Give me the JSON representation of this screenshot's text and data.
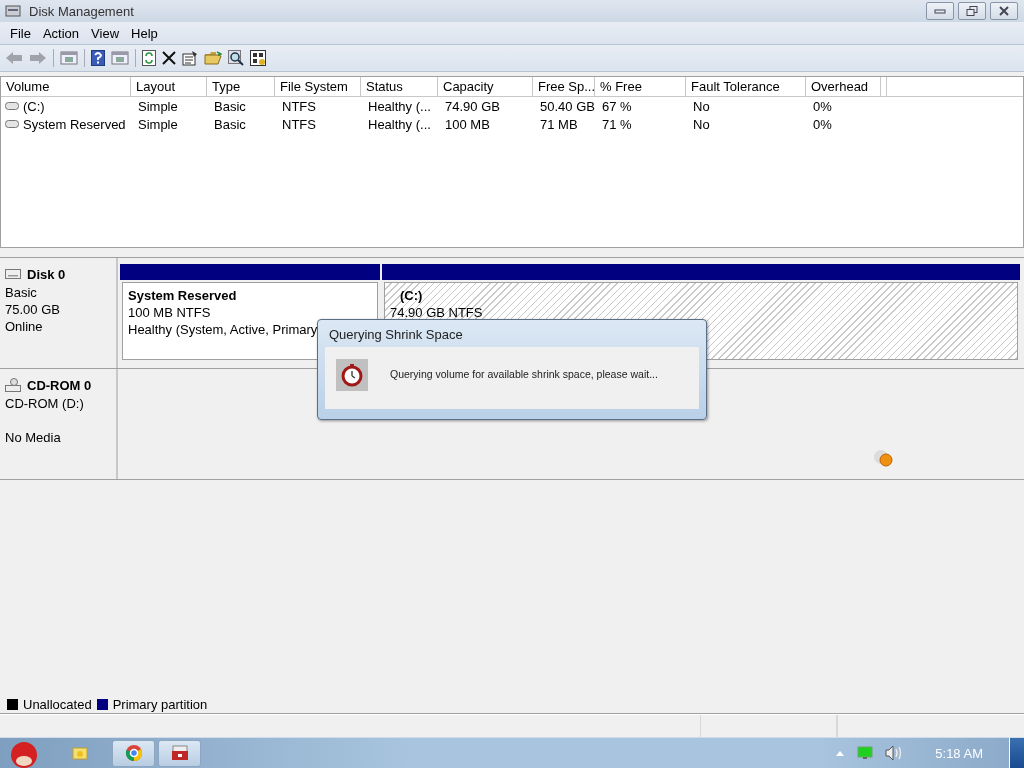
{
  "window": {
    "title": "Disk Management"
  },
  "menu": [
    "File",
    "Action",
    "View",
    "Help"
  ],
  "table": {
    "columns": [
      {
        "label": "Volume"
      },
      {
        "label": "Layout"
      },
      {
        "label": "Type"
      },
      {
        "label": "File System"
      },
      {
        "label": "Status"
      },
      {
        "label": "Capacity"
      },
      {
        "label": "Free Sp..."
      },
      {
        "label": "% Free"
      },
      {
        "label": "Fault Tolerance"
      },
      {
        "label": "Overhead"
      }
    ],
    "rows": [
      {
        "cells": [
          "(C:)",
          "Simple",
          "Basic",
          "NTFS",
          "Healthy (...",
          "74.90 GB",
          "50.40 GB",
          "67 %",
          "No",
          "0%"
        ]
      },
      {
        "cells": [
          "System Reserved",
          "Simple",
          "Basic",
          "NTFS",
          "Healthy (...",
          "100 MB",
          "71 MB",
          "71 %",
          "No",
          "0%"
        ]
      }
    ]
  },
  "disks": [
    {
      "kind": "disk",
      "name": "Disk 0",
      "lines": [
        "Basic",
        "75.00 GB",
        "Online"
      ],
      "partitions": [
        {
          "name": "System Reserved",
          "size": "100 MB NTFS",
          "status": "Healthy (System, Active, Primary",
          "hatched": false
        },
        {
          "name": "(C:)",
          "size": "74.90 GB NTFS",
          "hatched": true
        }
      ]
    },
    {
      "kind": "cdrom",
      "name": "CD-ROM 0",
      "lines": [
        "CD-ROM (D:)",
        "No Media"
      ]
    }
  ],
  "dialog": {
    "title": "Querying Shrink Space",
    "message": "Querying volume for available shrink space, please wait..."
  },
  "legend": [
    {
      "label": "Unallocated",
      "color": "#000000"
    },
    {
      "label": "Primary partition",
      "color": "#000080"
    }
  ],
  "taskbar": {
    "clock": "5:18 AM"
  }
}
